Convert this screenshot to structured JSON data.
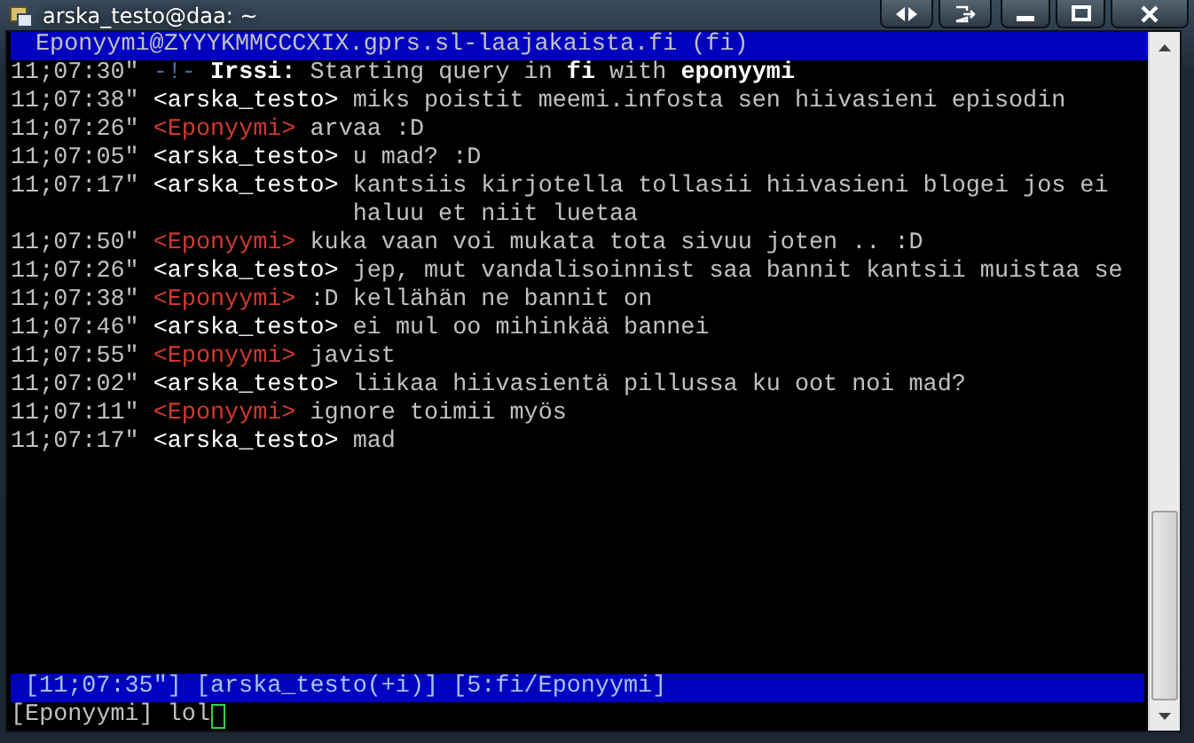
{
  "window": {
    "title": "arska_testo@daa: ~"
  },
  "topic": "Eponyymi@ZYYYKMMCCCXIX.gprs.sl-laajakaista.fi (fi)",
  "lines": [
    {
      "kind": "system",
      "time": "11;07:30\"",
      "marker": "-!-",
      "text": "**Irssi:** Starting query in **fi** with **eponyymi**"
    },
    {
      "kind": "message",
      "time": "11;07:38\"",
      "nick": "<arska_testo>",
      "color": "#ffffff",
      "text": "miks poistit meemi.infosta sen hiivasieni episodin"
    },
    {
      "kind": "message",
      "time": "11;07:26\"",
      "nick": "<Eponyymi>",
      "color": "#d03a30",
      "text": "arvaa :D"
    },
    {
      "kind": "message",
      "time": "11;07:05\"",
      "nick": "<arska_testo>",
      "color": "#ffffff",
      "text": "u mad? :D"
    },
    {
      "kind": "message",
      "time": "11;07:17\"",
      "nick": "<arska_testo>",
      "color": "#ffffff",
      "text": "kantsiis kirjotella tollasii hiivasieni blogei jos ei"
    },
    {
      "kind": "continuation",
      "text": "haluu et niit luetaa"
    },
    {
      "kind": "message",
      "time": "11;07:50\"",
      "nick": "<Eponyymi>",
      "color": "#d03a30",
      "text": "kuka vaan voi mukata tota sivuu joten .. :D"
    },
    {
      "kind": "message",
      "time": "11;07:26\"",
      "nick": "<arska_testo>",
      "color": "#ffffff",
      "text": "jep, mut vandalisoinnist saa bannit kantsii muistaa se"
    },
    {
      "kind": "message",
      "time": "11;07:38\"",
      "nick": "<Eponyymi>",
      "color": "#d03a30",
      "text": ":D kellähän ne bannit on"
    },
    {
      "kind": "message",
      "time": "11;07:46\"",
      "nick": "<arska_testo>",
      "color": "#ffffff",
      "text": "ei mul oo mihinkää bannei"
    },
    {
      "kind": "message",
      "time": "11;07:55\"",
      "nick": "<Eponyymi>",
      "color": "#d03a30",
      "text": "javist"
    },
    {
      "kind": "message",
      "time": "11;07:02\"",
      "nick": "<arska_testo>",
      "color": "#ffffff",
      "text": "liikaa hiivasientä pillussa ku oot noi mad?"
    },
    {
      "kind": "message",
      "time": "11;07:11\"",
      "nick": "<Eponyymi>",
      "color": "#d03a30",
      "text": "ignore toimii myös"
    },
    {
      "kind": "message",
      "time": "11;07:17\"",
      "nick": "<arska_testo>",
      "color": "#ffffff",
      "text": "mad"
    }
  ],
  "status_bar": [
    "[11;07:35\"]",
    "[arska_testo(+i)]",
    "[5:fi/Eponyymi]"
  ],
  "prompt": {
    "label": "[Eponyymi]",
    "value": "lol"
  }
}
